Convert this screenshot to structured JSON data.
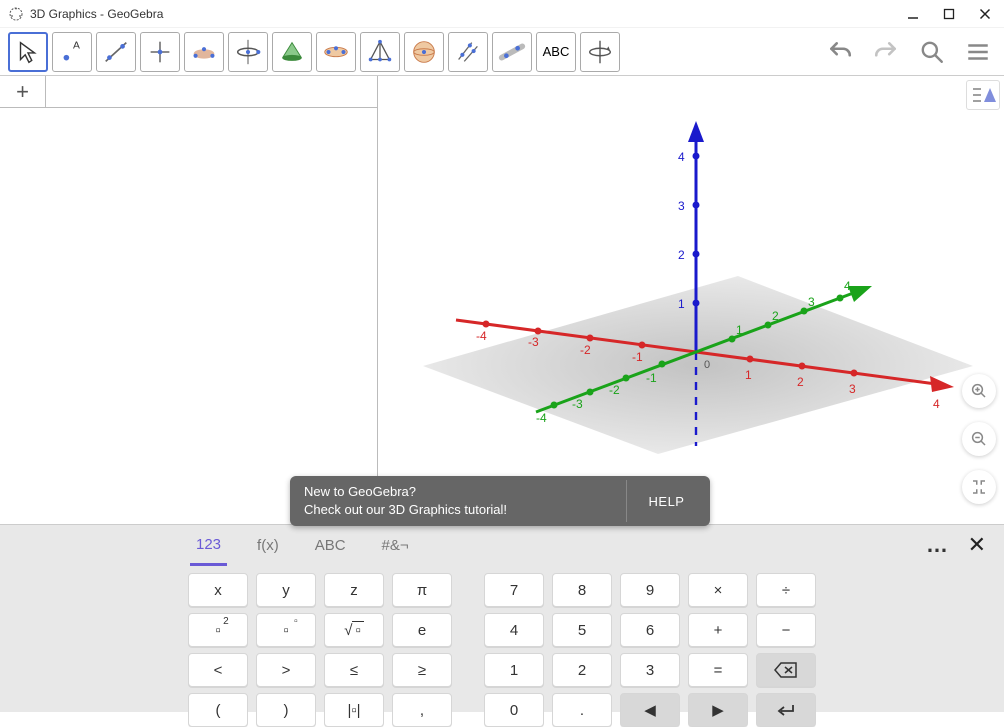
{
  "window": {
    "title": "3D Graphics - GeoGebra"
  },
  "toolbar": {
    "tools": [
      "move",
      "point",
      "line",
      "perpendicular",
      "polygon",
      "circle",
      "cone",
      "ellipse",
      "pyramid",
      "sphere",
      "plane-3pt",
      "net",
      "abc",
      "rotate-view"
    ],
    "abc_label": "ABC"
  },
  "hint": {
    "line1": "New to GeoGebra?",
    "line2": "Check out our 3D Graphics tutorial!",
    "help": "HELP"
  },
  "keyboard": {
    "tabs": {
      "t123": "123",
      "tfx": "f(x)",
      "tabc": "ABC",
      "tsym": "#&¬"
    },
    "rows": [
      [
        "x",
        "y",
        "z",
        "π",
        "|",
        "7",
        "8",
        "9",
        "×",
        "÷"
      ],
      [
        "▫²",
        "▫ⁿ",
        "√▫",
        "e",
        "|",
        "4",
        "5",
        "6",
        "+",
        "−"
      ],
      [
        "<",
        ">",
        "≤",
        "≥",
        "|",
        "1",
        "2",
        "3",
        "=",
        "⌫"
      ],
      [
        "(",
        ")",
        "|▫|",
        ",",
        "|",
        "0",
        ".",
        "◀",
        "▶",
        "↵"
      ]
    ]
  },
  "axis": {
    "x": {
      "ticks": [
        -4,
        -3,
        -2,
        -1,
        1,
        2,
        3,
        4
      ],
      "color": "#d62728"
    },
    "y": {
      "ticks": [
        -4,
        -3,
        -2,
        -1,
        1,
        2,
        3,
        4
      ],
      "color": "#1aa31a"
    },
    "z": {
      "ticks": [
        1,
        2,
        3,
        4
      ],
      "color": "#1a1acc"
    }
  }
}
